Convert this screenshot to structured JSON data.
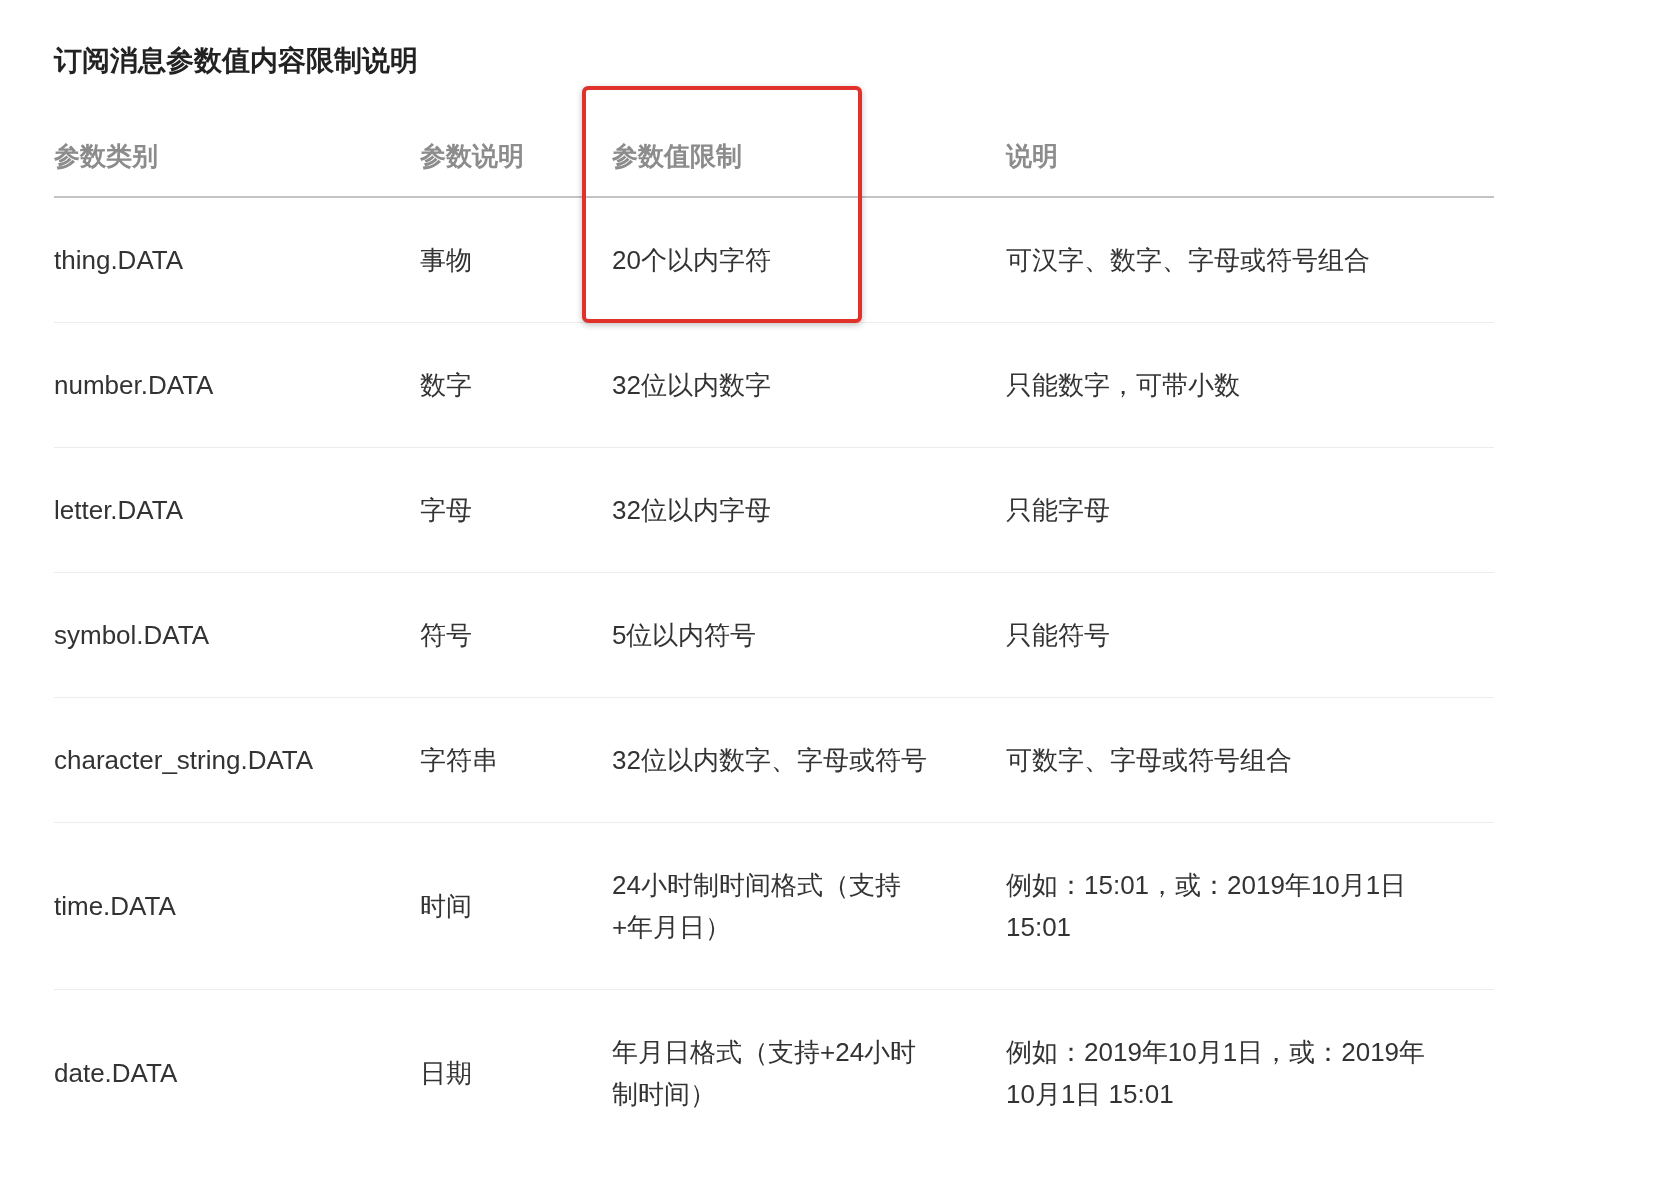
{
  "title": "订阅消息参数值内容限制说明",
  "table": {
    "columns": [
      {
        "label": "参数类别",
        "highlighted": false
      },
      {
        "label": "参数说明",
        "highlighted": false
      },
      {
        "label": "参数值限制",
        "highlighted": true
      },
      {
        "label": "说明",
        "highlighted": false
      }
    ],
    "rows": [
      [
        "thing.DATA",
        "事物",
        "20个以内字符",
        "可汉字、数字、字母或符号组合"
      ],
      [
        "number.DATA",
        "数字",
        "32位以内数字",
        "只能数字，可带小数"
      ],
      [
        "letter.DATA",
        "字母",
        "32位以内字母",
        "只能字母"
      ],
      [
        "symbol.DATA",
        "符号",
        "5位以内符号",
        "只能符号"
      ],
      [
        "character_string.DATA",
        "字符串",
        "32位以内数字、字母或符号",
        "可数字、字母或符号组合"
      ],
      [
        "time.DATA",
        "时间",
        "24小时制时间格式（支持+年月日）",
        "例如：15:01，或：2019年10月1日 15:01"
      ],
      [
        "date.DATA",
        "日期",
        "年月日格式（支持+24小时制时间）",
        "例如：2019年10月1日，或：2019年10月1日 15:01"
      ]
    ]
  }
}
